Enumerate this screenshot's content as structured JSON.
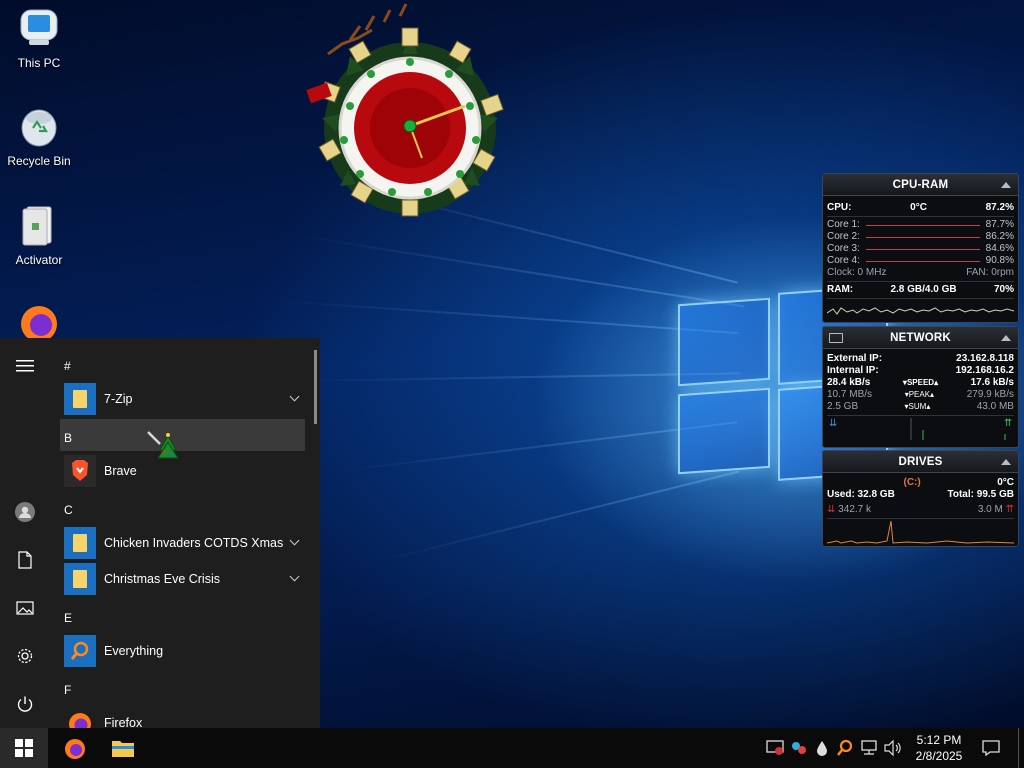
{
  "desktop": {
    "icons": [
      {
        "label": "This PC"
      },
      {
        "label": "Recycle Bin"
      },
      {
        "label": "Activator"
      },
      {
        "label": "Firefox"
      }
    ]
  },
  "gadgets": {
    "cpu_ram": {
      "title": "CPU-RAM",
      "cpu_label": "CPU:",
      "cpu_temp": "0°C",
      "cpu_value": "87.2%",
      "cores": [
        {
          "label": "Core 1:",
          "value": "87.7%"
        },
        {
          "label": "Core 2:",
          "value": "86.2%"
        },
        {
          "label": "Core 3:",
          "value": "84.6%"
        },
        {
          "label": "Core 4:",
          "value": "90.8%"
        }
      ],
      "clock_label": "Clock: 0 MHz",
      "fan_label": "FAN: 0rpm",
      "ram_label": "RAM:",
      "ram_usage": "2.8 GB/4.0 GB",
      "ram_percent": "70%"
    },
    "network": {
      "title": "NETWORK",
      "external_label": "External IP:",
      "external_ip": "23.162.8.118",
      "internal_label": "Internal IP:",
      "internal_ip": "192.168.16.2",
      "down_speed": "28.4 kB/s",
      "speed_label": "SPEED",
      "up_speed": "17.6 kB/s",
      "down_peak": "10.7 MB/s",
      "peak_label": "PEAK",
      "up_peak": "279.9 kB/s",
      "down_sum": "2.5 GB",
      "sum_label": "SUM",
      "up_sum": "43.0 MB"
    },
    "drives": {
      "title": "DRIVES",
      "drive_letter": "(C:)",
      "temp": "0°C",
      "used_label": "Used: 32.8 GB",
      "total_label": "Total: 99.5 GB",
      "read_rate": "342.7 k",
      "write_rate": "3.0 M"
    }
  },
  "start_menu": {
    "groups": [
      {
        "letter": "#"
      },
      {
        "letter": "B"
      },
      {
        "letter": "C"
      },
      {
        "letter": "E"
      },
      {
        "letter": "F"
      }
    ],
    "apps": [
      {
        "label": "7-Zip"
      },
      {
        "label": "Brave"
      },
      {
        "label": "Chicken Invaders COTDS Xmas"
      },
      {
        "label": "Christmas Eve Crisis"
      },
      {
        "label": "Everything"
      },
      {
        "label": "Firefox"
      }
    ]
  },
  "taskbar": {
    "time": "5:12 PM",
    "date": "2/8/2025"
  },
  "colors": {
    "accent": "#1a6fc0",
    "taskbar": "#0a0a0a",
    "start_menu": "#1e1e1e"
  }
}
